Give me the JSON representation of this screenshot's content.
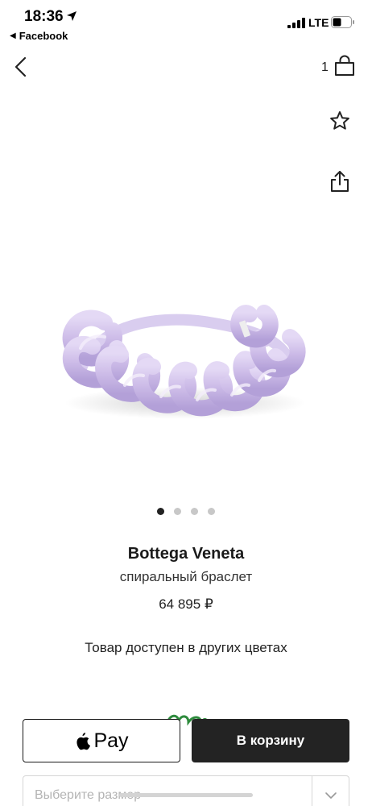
{
  "status_bar": {
    "time": "18:36",
    "back_app": "Facebook",
    "network": "LTE"
  },
  "header": {
    "cart_count": "1"
  },
  "gallery": {
    "pages": 4,
    "active_page": 1
  },
  "product": {
    "brand": "Bottega Veneta",
    "name": "спиральный браслет",
    "price": "64 895 ₽",
    "other_colors": "Товар доступен в других цветах",
    "image_color": "#cdbce8"
  },
  "actions": {
    "apple_pay_label": "Pay",
    "add_to_cart_label": "В корзину",
    "size_placeholder": "Выберите размер"
  },
  "colors": {
    "primary_button": "#232323",
    "text": "#1a1a1a"
  }
}
